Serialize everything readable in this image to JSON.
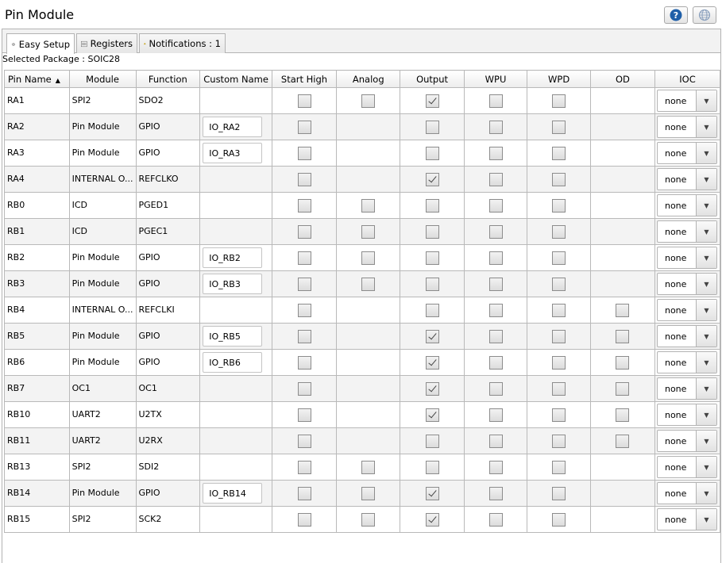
{
  "window": {
    "title": "Pin Module"
  },
  "tabs": [
    {
      "label": "Easy Setup"
    },
    {
      "label": "Registers"
    },
    {
      "label": "Notifications : 1"
    }
  ],
  "package_label": "Selected Package : SOIC28",
  "columns": [
    "Pin Name",
    "Module",
    "Function",
    "Custom Name",
    "Start High",
    "Analog",
    "Output",
    "WPU",
    "WPD",
    "OD",
    "IOC"
  ],
  "rows": [
    {
      "pin": "RA1",
      "module": "SPI2",
      "function": "SDO2",
      "custom": "",
      "start_high": false,
      "analog": false,
      "output": true,
      "wpu": false,
      "wpd": false,
      "od": null,
      "ioc": "none"
    },
    {
      "pin": "RA2",
      "module": "Pin Module",
      "function": "GPIO",
      "custom": "IO_RA2",
      "start_high": false,
      "analog": null,
      "output": false,
      "wpu": false,
      "wpd": false,
      "od": null,
      "ioc": "none"
    },
    {
      "pin": "RA3",
      "module": "Pin Module",
      "function": "GPIO",
      "custom": "IO_RA3",
      "start_high": false,
      "analog": null,
      "output": false,
      "wpu": false,
      "wpd": false,
      "od": null,
      "ioc": "none"
    },
    {
      "pin": "RA4",
      "module": "INTERNAL O...",
      "function": "REFCLKO",
      "custom": "",
      "start_high": false,
      "analog": null,
      "output": true,
      "wpu": false,
      "wpd": false,
      "od": null,
      "ioc": "none"
    },
    {
      "pin": "RB0",
      "module": "ICD",
      "function": "PGED1",
      "custom": "",
      "start_high": false,
      "analog": false,
      "output": false,
      "wpu": false,
      "wpd": false,
      "od": null,
      "ioc": "none"
    },
    {
      "pin": "RB1",
      "module": "ICD",
      "function": "PGEC1",
      "custom": "",
      "start_high": false,
      "analog": false,
      "output": false,
      "wpu": false,
      "wpd": false,
      "od": null,
      "ioc": "none"
    },
    {
      "pin": "RB2",
      "module": "Pin Module",
      "function": "GPIO",
      "custom": "IO_RB2",
      "start_high": false,
      "analog": false,
      "output": false,
      "wpu": false,
      "wpd": false,
      "od": null,
      "ioc": "none"
    },
    {
      "pin": "RB3",
      "module": "Pin Module",
      "function": "GPIO",
      "custom": "IO_RB3",
      "start_high": false,
      "analog": false,
      "output": false,
      "wpu": false,
      "wpd": false,
      "od": null,
      "ioc": "none"
    },
    {
      "pin": "RB4",
      "module": "INTERNAL O...",
      "function": "REFCLKI",
      "custom": "",
      "start_high": false,
      "analog": null,
      "output": false,
      "wpu": false,
      "wpd": false,
      "od": false,
      "ioc": "none"
    },
    {
      "pin": "RB5",
      "module": "Pin Module",
      "function": "GPIO",
      "custom": "IO_RB5",
      "start_high": false,
      "analog": null,
      "output": true,
      "wpu": false,
      "wpd": false,
      "od": false,
      "ioc": "none"
    },
    {
      "pin": "RB6",
      "module": "Pin Module",
      "function": "GPIO",
      "custom": "IO_RB6",
      "start_high": false,
      "analog": null,
      "output": true,
      "wpu": false,
      "wpd": false,
      "od": false,
      "ioc": "none"
    },
    {
      "pin": "RB7",
      "module": "OC1",
      "function": "OC1",
      "custom": "",
      "start_high": false,
      "analog": null,
      "output": true,
      "wpu": false,
      "wpd": false,
      "od": false,
      "ioc": "none"
    },
    {
      "pin": "RB10",
      "module": "UART2",
      "function": "U2TX",
      "custom": "",
      "start_high": false,
      "analog": null,
      "output": true,
      "wpu": false,
      "wpd": false,
      "od": false,
      "ioc": "none"
    },
    {
      "pin": "RB11",
      "module": "UART2",
      "function": "U2RX",
      "custom": "",
      "start_high": false,
      "analog": null,
      "output": false,
      "wpu": false,
      "wpd": false,
      "od": false,
      "ioc": "none"
    },
    {
      "pin": "RB13",
      "module": "SPI2",
      "function": "SDI2",
      "custom": "",
      "start_high": false,
      "analog": false,
      "output": false,
      "wpu": false,
      "wpd": false,
      "od": null,
      "ioc": "none"
    },
    {
      "pin": "RB14",
      "module": "Pin Module",
      "function": "GPIO",
      "custom": "IO_RB14",
      "start_high": false,
      "analog": false,
      "output": true,
      "wpu": false,
      "wpd": false,
      "od": null,
      "ioc": "none"
    },
    {
      "pin": "RB15",
      "module": "SPI2",
      "function": "SCK2",
      "custom": "",
      "start_high": false,
      "analog": false,
      "output": true,
      "wpu": false,
      "wpd": false,
      "od": null,
      "ioc": "none"
    }
  ],
  "colors": {
    "help_blue": "#1f5fa8",
    "warning_yellow": "#f5c400"
  },
  "icons": {
    "help": "help-icon",
    "globe": "globe-icon",
    "gear": "gear-icon",
    "registers": "registers-icon",
    "warning": "warning-icon",
    "sort": "sort-ascending-icon",
    "dropdown": "chevron-down-icon"
  }
}
